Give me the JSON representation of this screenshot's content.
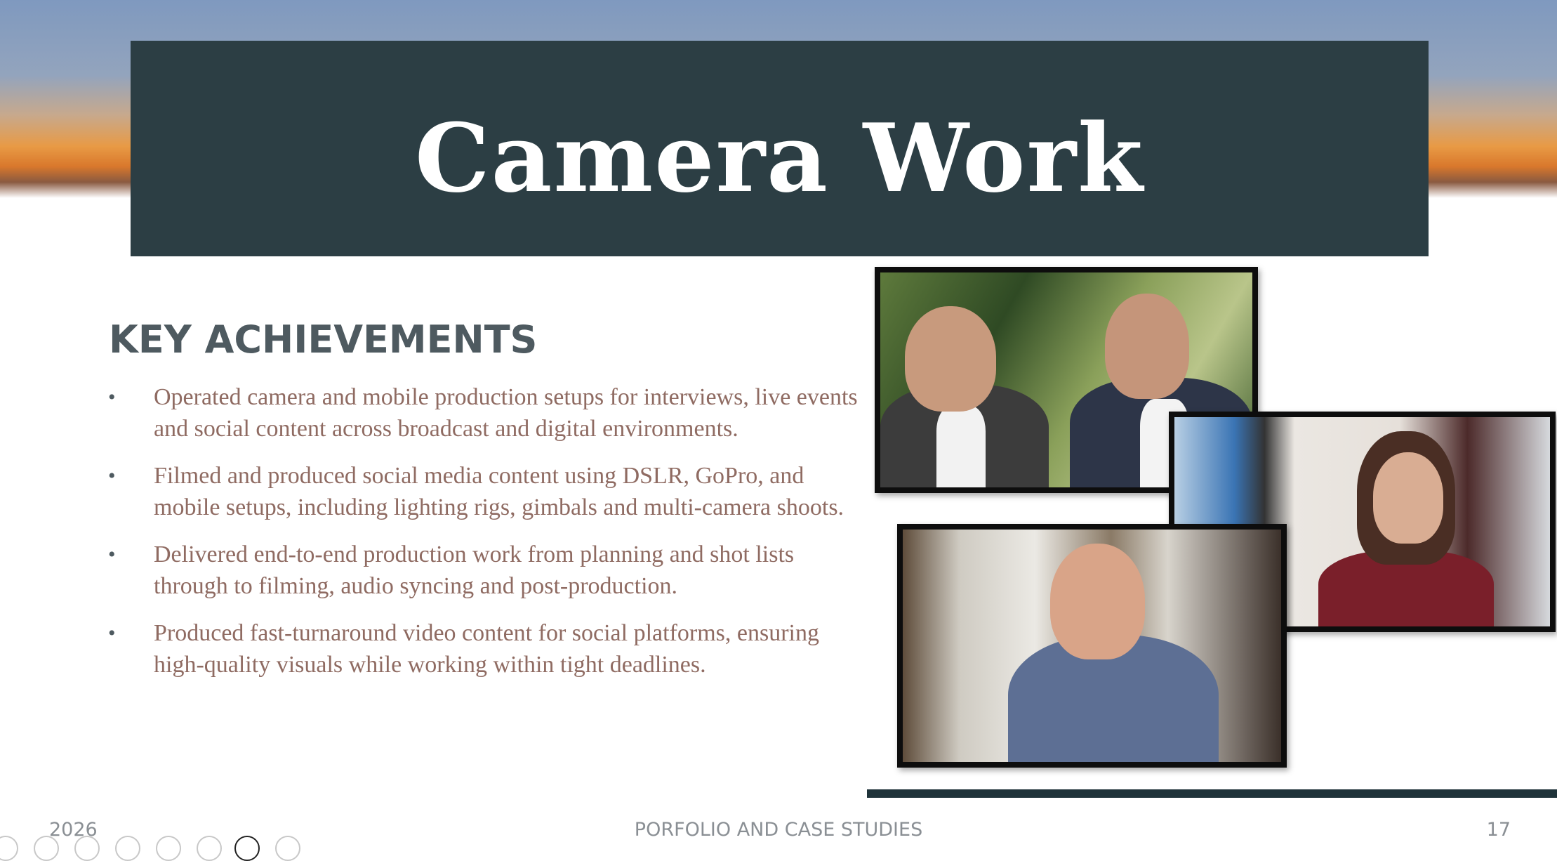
{
  "slide": {
    "title": "Camera Work",
    "section_heading": "KEY ACHIEVEMENTS",
    "bullet_symbol": "•",
    "bullets": [
      "Operated camera and mobile production setups for interviews, live events and social content across broadcast and digital environments.",
      "Filmed and produced social media content using DSLR, GoPro, and mobile setups, including lighting rigs, gimbals and multi-camera shoots.",
      "Delivered end-to-end production work from planning and shot lists through to filming, audio syncing and post-production.",
      "Produced fast-turnaround video content for social platforms, ensuring high-quality visuals while working within tight deadlines."
    ]
  },
  "footer": {
    "year": "2026",
    "center": "PORFOLIO AND CASE STUDIES",
    "page_number": "17"
  },
  "images": [
    {
      "name": "interview-photo-two-men"
    },
    {
      "name": "interview-photo-woman"
    },
    {
      "name": "interview-photo-man"
    }
  ],
  "colors": {
    "title_band": "#2c3e44",
    "title_text": "#ffffff",
    "heading": "#4e5a60",
    "bullet_text": "#8f6b62",
    "footer_text": "#8a8f94",
    "accent_line": "#1f333a"
  },
  "toolbar": {
    "icons": [
      "back-icon",
      "forward-icon",
      "pen-icon",
      "text-icon",
      "zoom-icon",
      "subtitles-icon",
      "slides-icon",
      "more-icon"
    ]
  }
}
